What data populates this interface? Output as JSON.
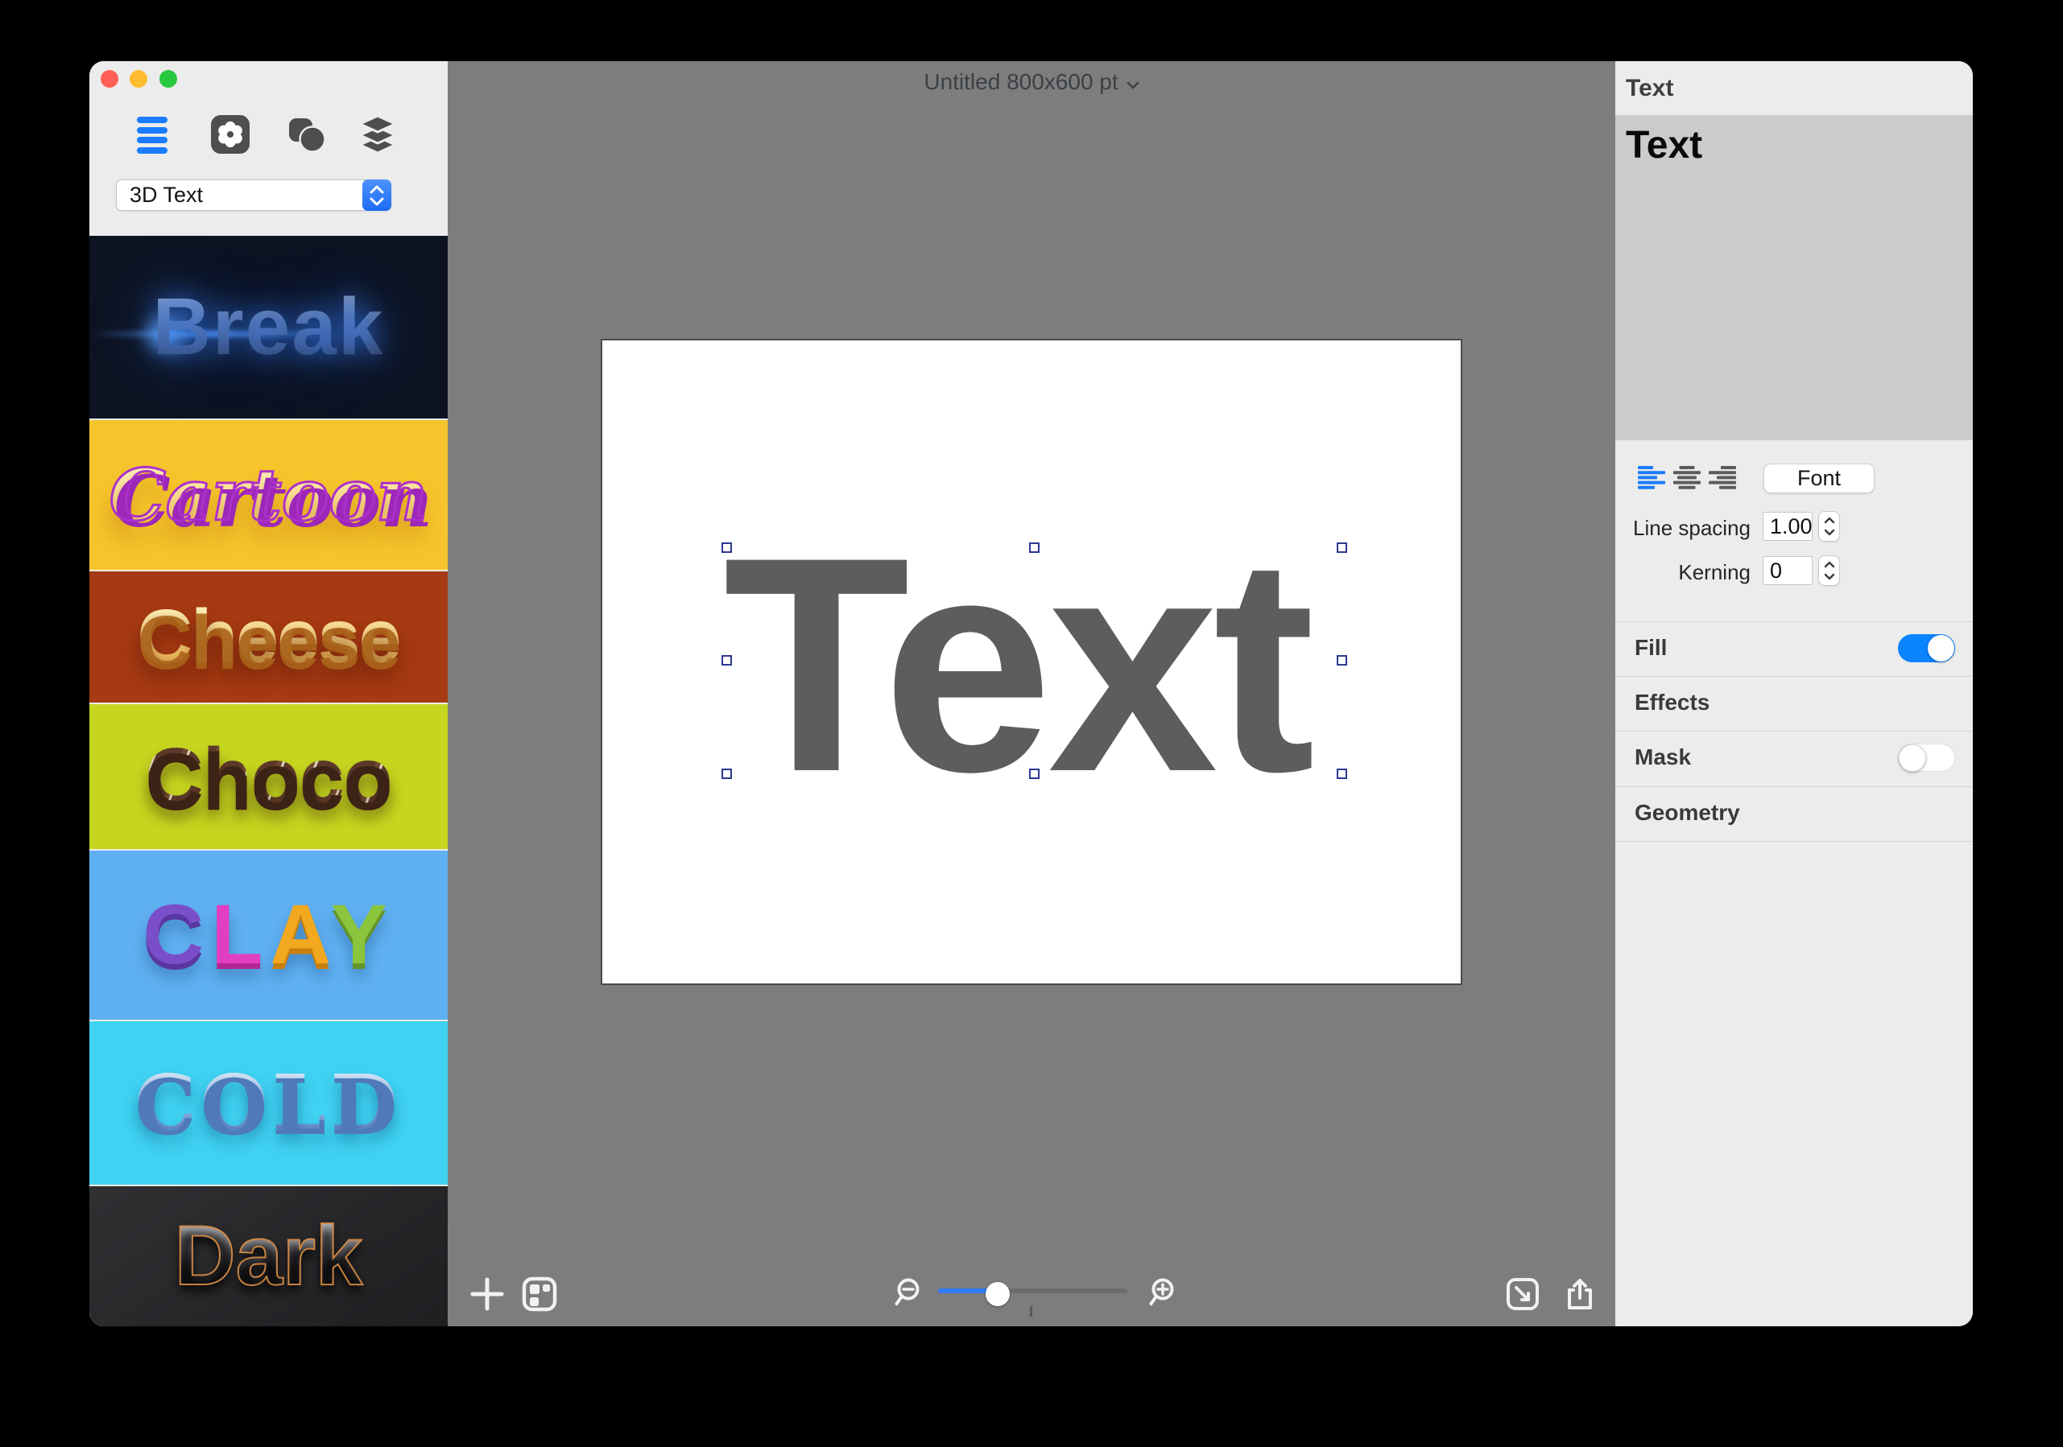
{
  "window": {
    "title": "Untitled 800x600 pt"
  },
  "sidebar": {
    "dropdown_value": "3D Text",
    "styles": [
      {
        "label": "Break",
        "bg": "#0d1322"
      },
      {
        "label": "Cartoon",
        "bg": "#f6c52b"
      },
      {
        "label": "Cheese",
        "bg": "#a63a12"
      },
      {
        "label": "Choco",
        "bg": "#c6d61f"
      },
      {
        "label": "CLAY",
        "bg": "#5fb0f2"
      },
      {
        "label": "COLD",
        "bg": "#3fd2f2"
      },
      {
        "label": "Dark",
        "bg": "#232326"
      }
    ]
  },
  "canvas": {
    "text": "Text",
    "zoom_slider_fraction": 0.31
  },
  "panel": {
    "header": "Text",
    "text_content": "Text",
    "font_button": "Font",
    "line_spacing_label": "Line spacing",
    "line_spacing_value": "1.00",
    "kerning_label": "Kerning",
    "kerning_value": "0",
    "sections": {
      "fill": "Fill",
      "effects": "Effects",
      "mask": "Mask",
      "geometry": "Geometry"
    },
    "toggles": {
      "fill": "on",
      "mask": "off"
    }
  },
  "icons": {
    "sidebar_toolbar": [
      "text-styles-icon",
      "gear-icon",
      "shapes-icon",
      "layers-icon"
    ],
    "bottom_toolbar": [
      "plus-icon",
      "collage-icon",
      "zoom-out-icon",
      "zoom-in-icon",
      "expand-icon",
      "share-icon"
    ]
  },
  "colors": {
    "accent_blue": "#1a7cfc",
    "toggle_on_blue": "#0a84ff",
    "canvas_background": "#7d7d7d",
    "panel_background": "#ececec",
    "edit_area_background": "#cbcbcb",
    "canvas_text_fill": "#5d5d5d",
    "traffic_red": "#ff5f57",
    "traffic_yellow": "#febc2e",
    "traffic_green": "#28c840"
  }
}
